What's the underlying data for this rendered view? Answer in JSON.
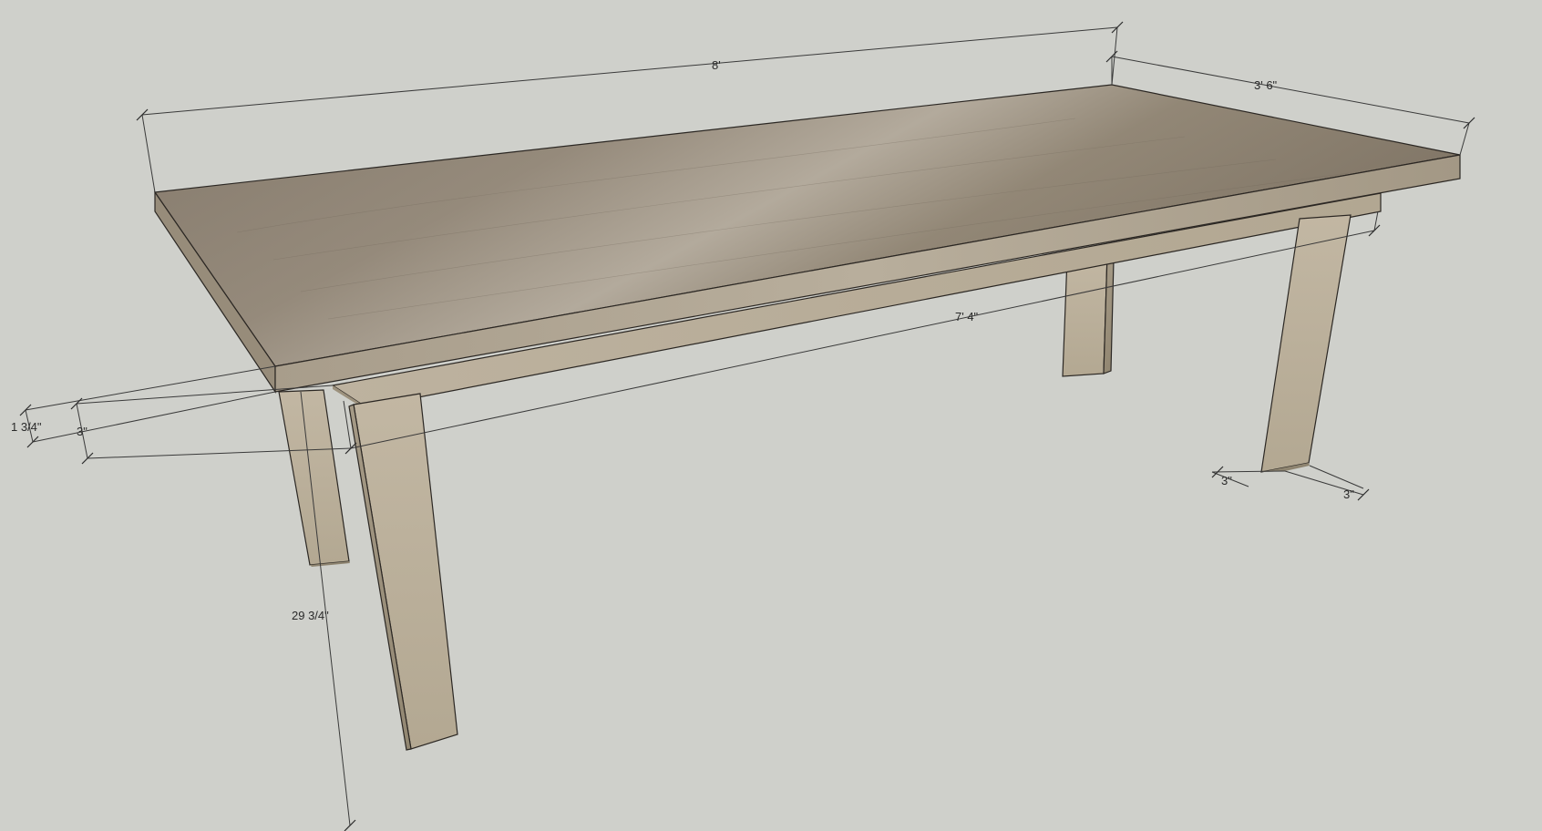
{
  "diagram": {
    "subject": "",
    "dimensions": {
      "length": "8'",
      "width": "3' 6\"",
      "apron_length": "7' 4\"",
      "top_thickness": "1 3/4\"",
      "apron_height": "3\"",
      "leg_height": "29 3/4\"",
      "leg_depth": "3\"",
      "leg_width": "3\""
    }
  },
  "colors": {
    "background": "#cfd0cb",
    "top_surface": "#8a8074",
    "top_edge": "#a59a8a",
    "apron": "#b5aa97",
    "leg_front": "#bfb49f",
    "leg_side": "#9e937f",
    "dimension_line": "#3a3a3a"
  }
}
